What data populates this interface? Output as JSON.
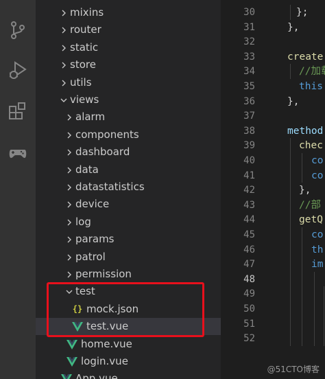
{
  "activity_bar": {
    "icons": [
      "source-control-icon",
      "run-debug-icon",
      "extensions-icon",
      "remote-gamepad-icon"
    ]
  },
  "explorer": {
    "items": [
      {
        "label": "mixins",
        "kind": "folder"
      },
      {
        "label": "router",
        "kind": "folder"
      },
      {
        "label": "static",
        "kind": "folder"
      },
      {
        "label": "store",
        "kind": "folder"
      },
      {
        "label": "utils",
        "kind": "folder"
      },
      {
        "label": "views",
        "kind": "folder-open"
      },
      {
        "label": "alarm",
        "kind": "folder"
      },
      {
        "label": "components",
        "kind": "folder"
      },
      {
        "label": "dashboard",
        "kind": "folder"
      },
      {
        "label": "data",
        "kind": "folder"
      },
      {
        "label": "datastatistics",
        "kind": "folder"
      },
      {
        "label": "device",
        "kind": "folder"
      },
      {
        "label": "log",
        "kind": "folder"
      },
      {
        "label": "params",
        "kind": "folder"
      },
      {
        "label": "patrol",
        "kind": "folder"
      },
      {
        "label": "permission",
        "kind": "folder"
      },
      {
        "label": "test",
        "kind": "folder-open"
      },
      {
        "label": "mock.json",
        "kind": "json"
      },
      {
        "label": "test.vue",
        "kind": "vue"
      },
      {
        "label": "home.vue",
        "kind": "vue"
      },
      {
        "label": "login.vue",
        "kind": "vue"
      },
      {
        "label": "App.vue",
        "kind": "vue"
      }
    ],
    "json_icon_glyph": "{}"
  },
  "editor": {
    "line_numbers": [
      "30",
      "31",
      "32",
      "33",
      "34",
      "35",
      "36",
      "37",
      "38",
      "39",
      "40",
      "41",
      "42",
      "43",
      "44",
      "45",
      "46",
      "47",
      "48",
      "49",
      "50",
      "51",
      "52"
    ],
    "active_line": "48",
    "code_lines": [
      {
        "text": "};",
        "color": "#d4d4d4"
      },
      {
        "text": "},",
        "color": "#d4d4d4"
      },
      {
        "text": "",
        "color": "#d4d4d4"
      },
      {
        "text": "create",
        "color": "#dcdcaa"
      },
      {
        "text": "//加载",
        "color": "#6a9955"
      },
      {
        "text": "this",
        "color": "#569cd6"
      },
      {
        "text": "},",
        "color": "#d4d4d4"
      },
      {
        "text": "",
        "color": "#d4d4d4"
      },
      {
        "text": "method",
        "color": "#9cdcfe"
      },
      {
        "text": "chec",
        "color": "#dcdcaa"
      },
      {
        "text": "co",
        "color": "#569cd6"
      },
      {
        "text": "co",
        "color": "#569cd6"
      },
      {
        "text": "},",
        "color": "#d4d4d4"
      },
      {
        "text": "//部",
        "color": "#6a9955"
      },
      {
        "text": "getQ",
        "color": "#dcdcaa"
      },
      {
        "text": "co",
        "color": "#569cd6"
      },
      {
        "text": "th",
        "color": "#569cd6"
      },
      {
        "text": "im",
        "color": "#569cd6"
      },
      {
        "text": "",
        "color": "#d4d4d4"
      },
      {
        "text": "",
        "color": "#d4d4d4"
      },
      {
        "text": "",
        "color": "#d4d4d4"
      },
      {
        "text": "",
        "color": "#d4d4d4"
      },
      {
        "text": "",
        "color": "#d4d4d4"
      }
    ]
  },
  "watermark": "@51CTO博客",
  "colors": {
    "highlight_box": "#e8101c",
    "vue_green": "#41b883",
    "json_yellow": "#cbcb41"
  }
}
